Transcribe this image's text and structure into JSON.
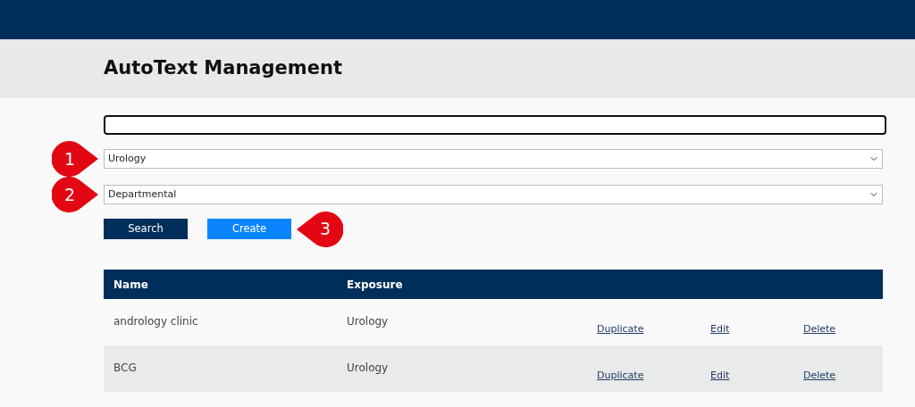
{
  "page": {
    "title": "AutoText Management"
  },
  "filters": [
    {
      "value": "Urology"
    },
    {
      "value": "Departmental"
    }
  ],
  "buttons": [
    {
      "label": "Search",
      "kind": "primary"
    },
    {
      "label": "Create",
      "kind": "action"
    }
  ],
  "table": {
    "columns": [
      "Name",
      "Exposure"
    ],
    "rows": [
      {
        "name": "andrology clinic",
        "exposure": "Urology",
        "actions": [
          "Duplicate",
          "Edit",
          "Delete"
        ]
      },
      {
        "name": "BCG",
        "exposure": "Urology",
        "actions": [
          "Duplicate",
          "Edit",
          "Delete"
        ]
      }
    ]
  },
  "callouts": [
    {
      "label": "1"
    },
    {
      "label": "2"
    },
    {
      "label": "3"
    }
  ]
}
